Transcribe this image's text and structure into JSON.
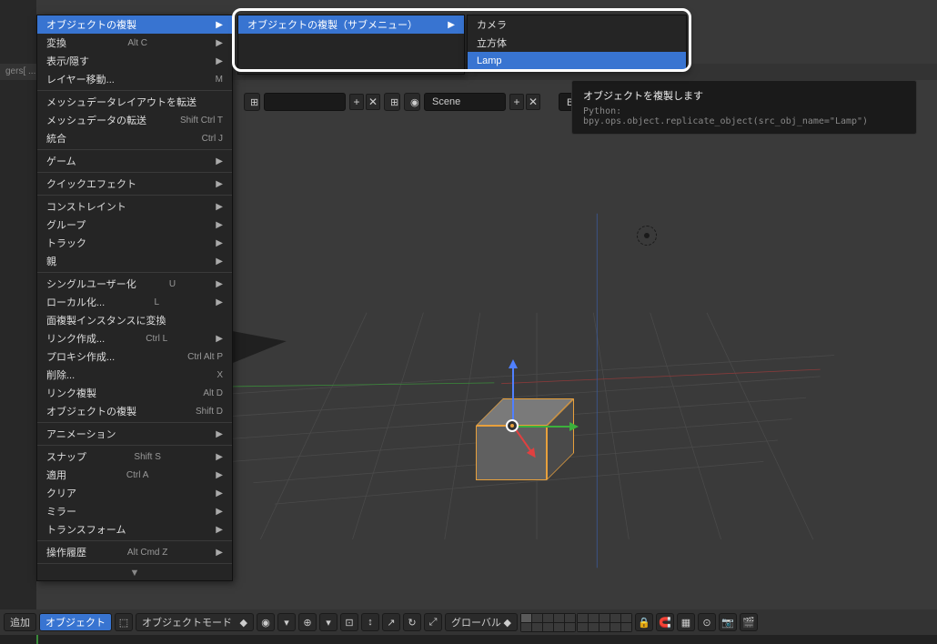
{
  "top_strip": "gers[ ... support = ( ... ) ]",
  "header": {
    "field1": "",
    "scene_label": "Scene",
    "render_label": "Blenderレン"
  },
  "main_menu": {
    "title": "オブジェクトの複製",
    "items": [
      {
        "label": "変換",
        "shortcut": "Alt C",
        "arrow": true
      },
      {
        "label": "表示/隠す",
        "shortcut": "",
        "arrow": true
      },
      {
        "label": "レイヤー移動...",
        "shortcut": "M",
        "arrow": false
      },
      {
        "sep": true
      },
      {
        "label": "メッシュデータレイアウトを転送",
        "shortcut": "",
        "arrow": false
      },
      {
        "label": "メッシュデータの転送",
        "shortcut": "Shift Ctrl T",
        "arrow": false
      },
      {
        "label": "統合",
        "shortcut": "Ctrl J",
        "arrow": false
      },
      {
        "sep": true
      },
      {
        "label": "ゲーム",
        "shortcut": "",
        "arrow": true
      },
      {
        "sep": true
      },
      {
        "label": "クイックエフェクト",
        "shortcut": "",
        "arrow": true
      },
      {
        "sep": true
      },
      {
        "label": "コンストレイント",
        "shortcut": "",
        "arrow": true
      },
      {
        "label": "グループ",
        "shortcut": "",
        "arrow": true
      },
      {
        "label": "トラック",
        "shortcut": "",
        "arrow": true
      },
      {
        "label": "親",
        "shortcut": "",
        "arrow": true
      },
      {
        "sep": true
      },
      {
        "label": "シングルユーザー化",
        "shortcut": "U",
        "arrow": true
      },
      {
        "label": "ローカル化...",
        "shortcut": "L",
        "arrow": true
      },
      {
        "label": "面複製インスタンスに変換",
        "shortcut": "",
        "arrow": false
      },
      {
        "label": "リンク作成...",
        "shortcut": "Ctrl L",
        "arrow": true
      },
      {
        "label": "プロキシ作成...",
        "shortcut": "Ctrl Alt P",
        "arrow": false
      },
      {
        "label": "削除...",
        "shortcut": "X",
        "arrow": false
      },
      {
        "label": "リンク複製",
        "shortcut": "Alt D",
        "arrow": false
      },
      {
        "label": "オブジェクトの複製",
        "shortcut": "Shift D",
        "arrow": false
      },
      {
        "sep": true
      },
      {
        "label": "アニメーション",
        "shortcut": "",
        "arrow": true
      },
      {
        "sep": true
      },
      {
        "label": "スナップ",
        "shortcut": "Shift S",
        "arrow": true
      },
      {
        "label": "適用",
        "shortcut": "Ctrl A",
        "arrow": true
      },
      {
        "label": "クリア",
        "shortcut": "",
        "arrow": true
      },
      {
        "label": "ミラー",
        "shortcut": "",
        "arrow": true
      },
      {
        "label": "トランスフォーム",
        "shortcut": "",
        "arrow": true
      },
      {
        "sep": true
      },
      {
        "label": "操作履歴",
        "shortcut": "Alt Cmd Z",
        "arrow": true
      }
    ]
  },
  "submenu1": {
    "title": "オブジェクトの複製（サブメニュー）"
  },
  "submenu2": {
    "items": [
      {
        "label": "カメラ",
        "hl": false
      },
      {
        "label": "立方体",
        "hl": false
      },
      {
        "label": "Lamp",
        "hl": true
      }
    ]
  },
  "tooltip": {
    "title": "オブジェクトを複製します",
    "python": "Python: bpy.ops.object.replicate_object(src_obj_name=\"Lamp\")"
  },
  "footer": {
    "add": "追加",
    "object": "オブジェクト",
    "mode": "オブジェクトモード",
    "orient": "グローバル"
  }
}
